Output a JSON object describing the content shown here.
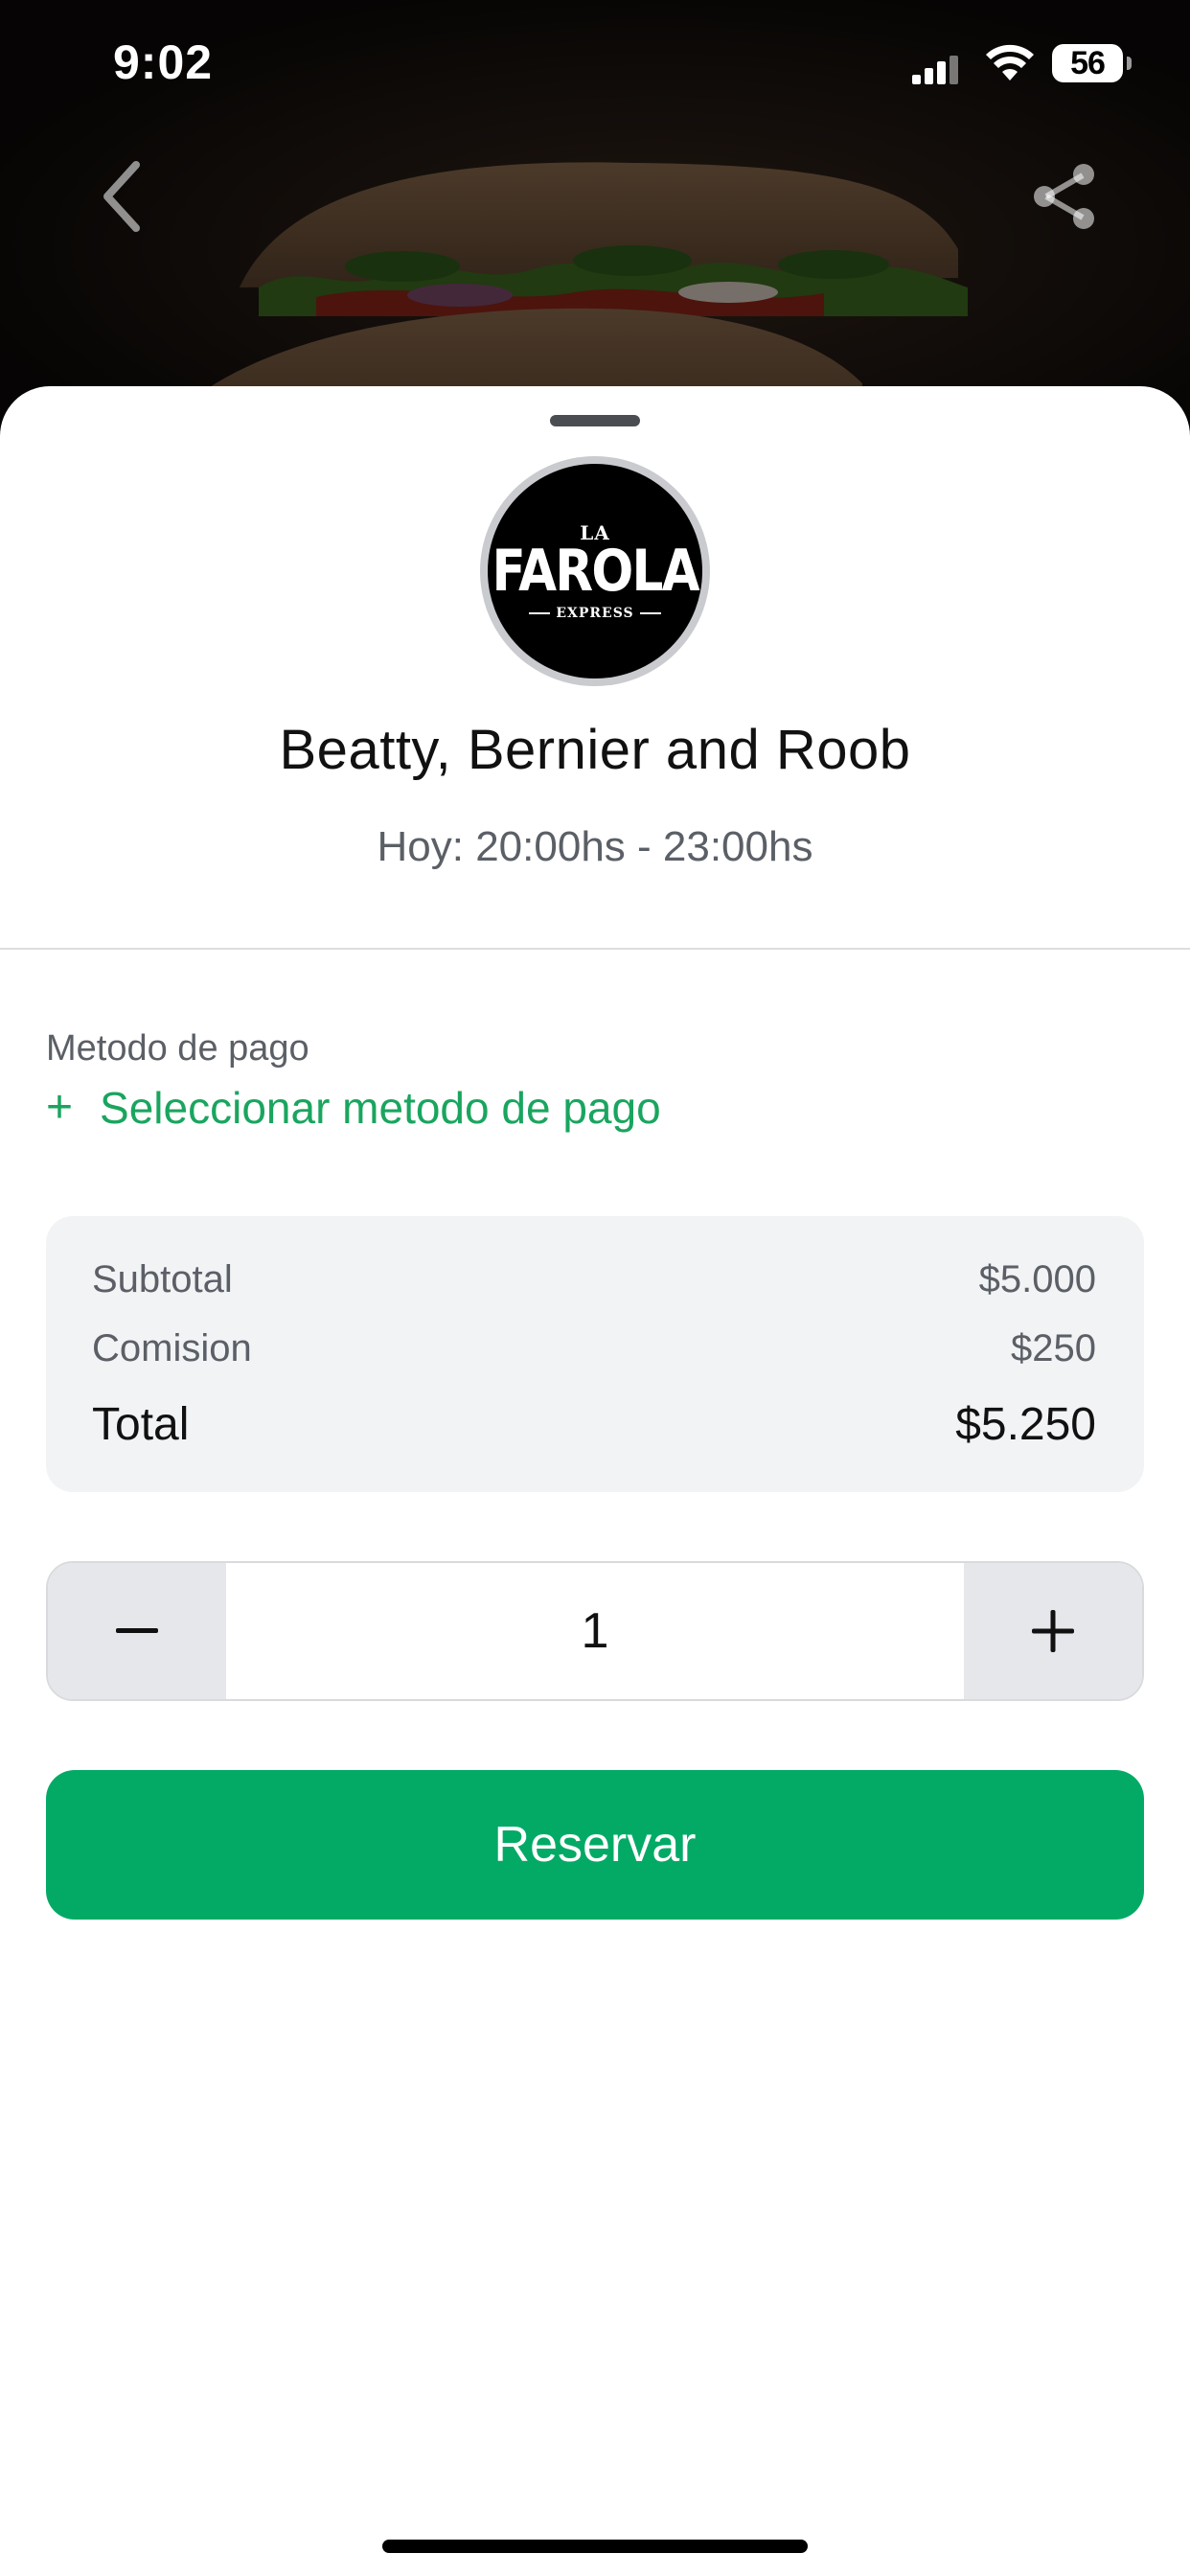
{
  "status_bar": {
    "time": "9:02",
    "battery": "56",
    "icons": [
      "signal-icon",
      "wifi-icon",
      "battery-icon"
    ]
  },
  "hero": {
    "image": "sandwich-photo",
    "back_icon": "chevron-left-icon",
    "share_icon": "share-icon"
  },
  "restaurant": {
    "logo": {
      "top_text": "LA",
      "name": "FAROLA",
      "sub_text": "EXPRESS"
    },
    "name": "Beatty, Bernier and Roob",
    "schedule": "Hoy: 20:00hs - 23:00hs"
  },
  "payment": {
    "label": "Metodo de pago",
    "action_icon": "+",
    "action": "Seleccionar metodo de pago"
  },
  "summary": {
    "rows": [
      {
        "label": "Subtotal",
        "value": "$5.000"
      },
      {
        "label": "Comision",
        "value": "$250"
      }
    ],
    "total": {
      "label": "Total",
      "value": "$5.250"
    }
  },
  "quantity": {
    "value": "1",
    "decrement_icon": "minus-icon",
    "increment_icon": "plus-icon"
  },
  "reserve": {
    "label": "Reservar"
  },
  "colors": {
    "accent": "#03aa65",
    "link": "#1aa55f",
    "muted_text": "#5b5f66",
    "card_bg": "#f2f3f5"
  }
}
